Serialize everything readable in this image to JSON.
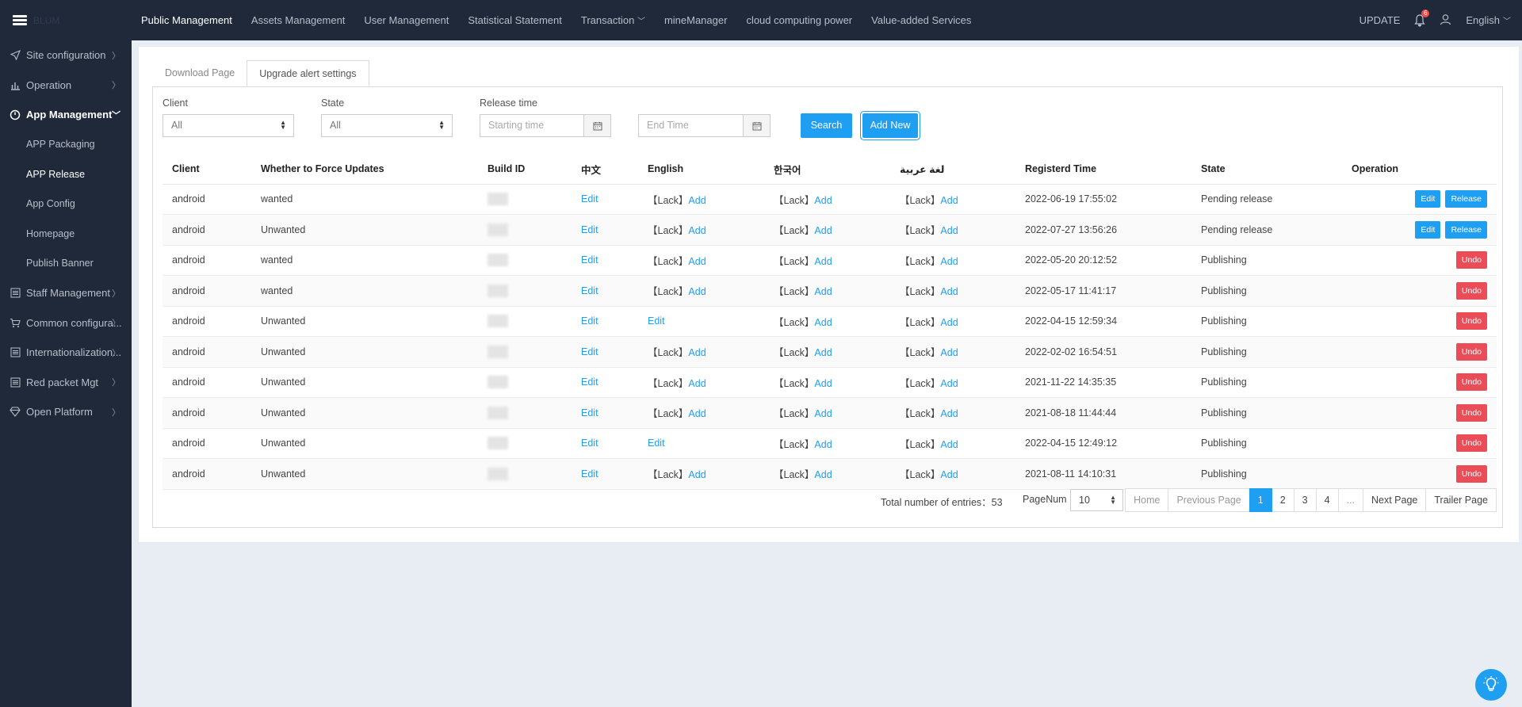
{
  "topbar": {
    "logo_text": "BLUM",
    "nav": [
      "Public Management",
      "Assets Management",
      "User Management",
      "Statistical Statement",
      "Transaction",
      "mineManager",
      "cloud computing power",
      "Value-added Services"
    ],
    "update_label": "UPDATE",
    "notification_count": "6",
    "language": "English"
  },
  "sidebar": {
    "items": [
      {
        "label": "Site configuration",
        "icon": "send-icon"
      },
      {
        "label": "Operation",
        "icon": "bar-chart-icon"
      },
      {
        "label": "App Management",
        "icon": "power-icon"
      },
      {
        "label": "Staff Management",
        "icon": "list-icon"
      },
      {
        "label": "Common configura...",
        "icon": "cart-icon"
      },
      {
        "label": "Internationalization...",
        "icon": "list-icon"
      },
      {
        "label": "Red packet Mgt",
        "icon": "list-icon"
      },
      {
        "label": "Open Platform",
        "icon": "diamond-icon"
      }
    ],
    "subitems": [
      "APP Packaging",
      "APP Release",
      "App Config",
      "Homepage",
      "Publish Banner"
    ]
  },
  "tabs": [
    "Download Page",
    "Upgrade alert settings"
  ],
  "filters": {
    "client_label": "Client",
    "client_value": "All",
    "state_label": "State",
    "state_value": "All",
    "release_label": "Release time",
    "start_placeholder": "Starting time",
    "end_placeholder": "End Time",
    "search_label": "Search",
    "add_label": "Add New"
  },
  "table": {
    "headers": [
      "Client",
      "Whether to Force Updates",
      "Build ID",
      "中文",
      "English",
      "한국어",
      "لغة عربية",
      "Registerd Time",
      "State",
      "Operation"
    ],
    "lack": "【Lack】",
    "add": "Add",
    "edit": "Edit",
    "release": "Release",
    "undo": "Undo",
    "rows": [
      {
        "client": "android",
        "force": "wanted",
        "en_edit": false,
        "time": "2022-06-19 17:55:02",
        "state": "Pending release",
        "pending": true
      },
      {
        "client": "android",
        "force": "Unwanted",
        "en_edit": false,
        "time": "2022-07-27 13:56:26",
        "state": "Pending release",
        "pending": true
      },
      {
        "client": "android",
        "force": "wanted",
        "en_edit": false,
        "time": "2022-05-20 20:12:52",
        "state": "Publishing",
        "pending": false
      },
      {
        "client": "android",
        "force": "wanted",
        "en_edit": false,
        "time": "2022-05-17 11:41:17",
        "state": "Publishing",
        "pending": false
      },
      {
        "client": "android",
        "force": "Unwanted",
        "en_edit": true,
        "time": "2022-04-15 12:59:34",
        "state": "Publishing",
        "pending": false
      },
      {
        "client": "android",
        "force": "Unwanted",
        "en_edit": false,
        "time": "2022-02-02 16:54:51",
        "state": "Publishing",
        "pending": false
      },
      {
        "client": "android",
        "force": "Unwanted",
        "en_edit": false,
        "time": "2021-11-22 14:35:35",
        "state": "Publishing",
        "pending": false
      },
      {
        "client": "android",
        "force": "Unwanted",
        "en_edit": false,
        "time": "2021-08-18 11:44:44",
        "state": "Publishing",
        "pending": false
      },
      {
        "client": "android",
        "force": "Unwanted",
        "en_edit": true,
        "time": "2022-04-15 12:49:12",
        "state": "Publishing",
        "pending": false
      },
      {
        "client": "android",
        "force": "Unwanted",
        "en_edit": false,
        "time": "2021-08-11 14:10:31",
        "state": "Publishing",
        "pending": false
      }
    ]
  },
  "pagination": {
    "total_text": "Total number of entries：53",
    "pagenum_label": "PageNum",
    "page_size": "10",
    "home": "Home",
    "prev": "Previous Page",
    "pages": [
      "1",
      "2",
      "3",
      "4",
      "..."
    ],
    "next": "Next Page",
    "trailer": "Trailer Page"
  },
  "colors": {
    "accent": "#1e9ff2",
    "danger": "#ea4d57",
    "sidebar": "#20293a"
  }
}
